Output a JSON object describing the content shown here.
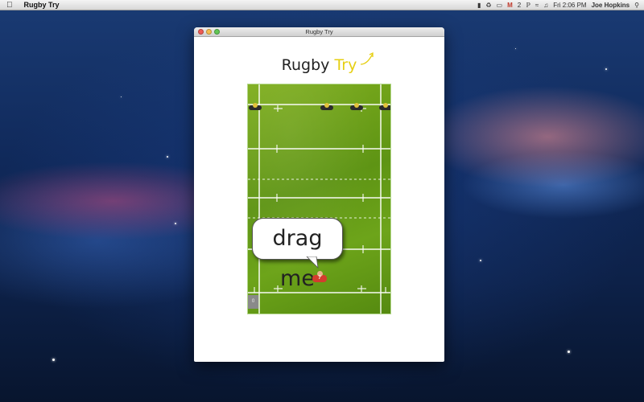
{
  "menubar": {
    "app_name": "Rugby Try",
    "tray": {
      "mail_count": "2",
      "clock": "Fri 2:06 PM",
      "user": "Joe Hopkins"
    }
  },
  "window": {
    "title": "Rugby Try"
  },
  "game": {
    "title_main": "Rugby",
    "title_accent": "Try",
    "hint": "drag me",
    "score": "0",
    "player_number": "7"
  },
  "colors": {
    "accent": "#e6cf12",
    "field": "#6da41a",
    "opponent": "#2b2b2b",
    "player": "#d33c2e"
  }
}
